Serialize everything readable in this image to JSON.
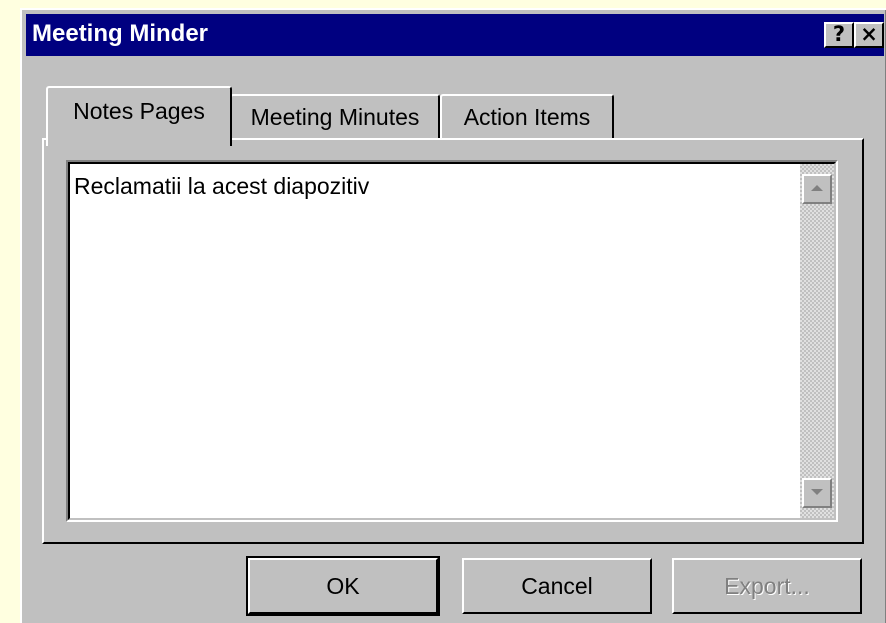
{
  "window": {
    "title": "Meeting Minder",
    "help_label": "?",
    "close_label": "×"
  },
  "tabs": [
    {
      "label": "Notes Pages",
      "selected": true
    },
    {
      "label": "Meeting Minutes",
      "selected": false
    },
    {
      "label": "Action Items",
      "selected": false
    }
  ],
  "notes": {
    "text": "Reclamatii la acest diapozitiv"
  },
  "buttons": {
    "ok": "OK",
    "cancel": "Cancel",
    "export": "Export..."
  },
  "colors": {
    "titlebar": "#000080",
    "dialog_face": "#C0C0C0",
    "page_background": "#FFFFE0"
  }
}
